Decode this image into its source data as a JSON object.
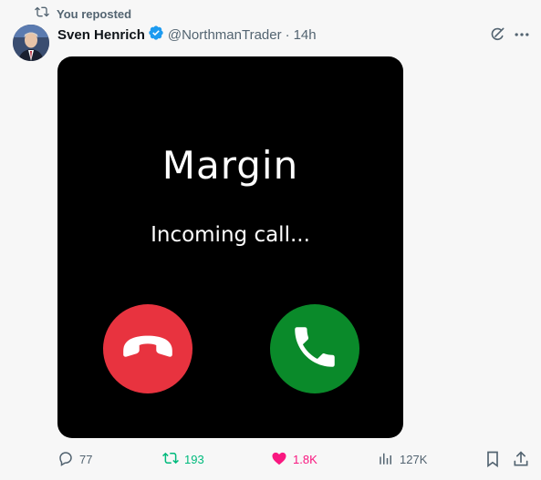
{
  "repost_header": {
    "text": "You reposted"
  },
  "author": {
    "name": "Sven Henrich",
    "handle": "@NorthmanTrader",
    "separator": "·",
    "time": "14h",
    "verified": true
  },
  "media": {
    "title": "Margin",
    "subtitle": "Incoming call..."
  },
  "actions": {
    "replies": "77",
    "reposts": "193",
    "likes": "1.8K",
    "views": "127K"
  },
  "colors": {
    "accent_repost": "#00ba7c",
    "accent_like": "#f91880",
    "verified_blue": "#1d9bf0",
    "decline_red": "#e8333f",
    "accept_green": "#0a8a2a"
  }
}
